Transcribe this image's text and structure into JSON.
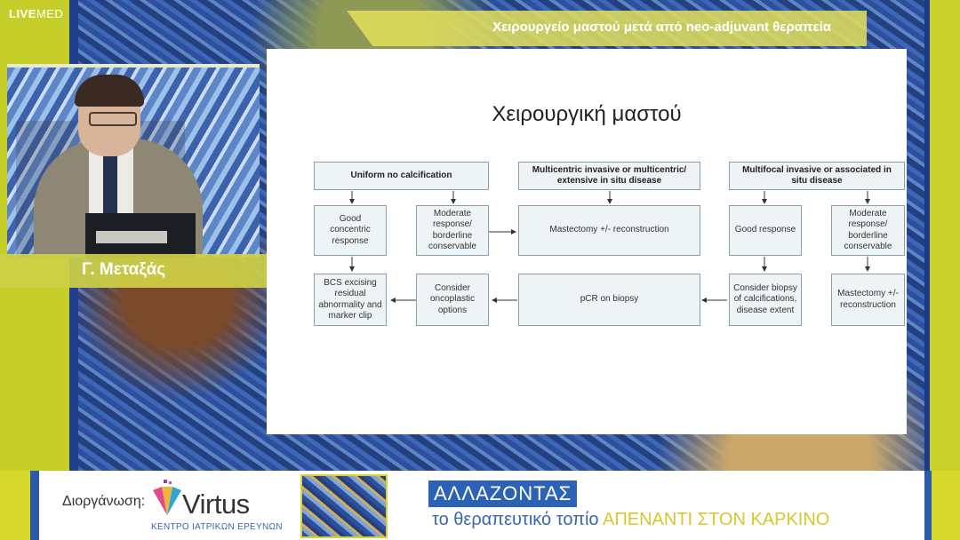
{
  "channel": {
    "logo_bold": "LIVE",
    "logo_light": "MED"
  },
  "header": {
    "title": "Χειρουργείο μαστού μετά από neo-adjuvant θεραπεία"
  },
  "speaker": {
    "name": "Γ. Μεταξάς"
  },
  "slide": {
    "title": "Χειρουργική μαστού",
    "boxes": {
      "uniform": "Uniform no calcification",
      "multicentric": "Multicentric invasive or multicentric/ extensive in situ disease",
      "multifocal": "Multifocal invasive or associated in situ disease",
      "good_concentric": "Good concentric response",
      "moderate_left": "Moderate response/ borderline conservable",
      "mastectomy_center": "Mastectomy +/- reconstruction",
      "good_response": "Good response",
      "moderate_right": "Moderate response/ borderline conservable",
      "bcs": "BCS excising residual abnormality and marker clip",
      "oncoplastic": "Consider oncoplastic options",
      "pcr": "pCR on biopsy",
      "consider_biopsy": "Consider biopsy of calcifications, disease extent",
      "mastectomy_right": "Mastectomy +/- reconstruction"
    }
  },
  "footer": {
    "organizer_label": "Διοργάνωση:",
    "org_name": "Virtus",
    "org_subtitle": "ΚΕΝΤΡΟ ΙΑΤΡΙΚΩΝ ΕΡΕΥΝΩΝ",
    "banner_title": "ΑΛΛΑΖΟΝΤΑΣ",
    "banner_sub_prefix": "το θεραπευτικό τοπίο",
    "banner_sub_highlight": "ΑΠΕΝΑΝΤΙ ΣΤΟΝ ΚΑΡΚΙΝΟ"
  },
  "colors": {
    "accent_yellow": "#c9d12c",
    "accent_blue": "#2b62b6",
    "box_fill": "#eef3f6",
    "box_border": "#8aa0b2"
  }
}
